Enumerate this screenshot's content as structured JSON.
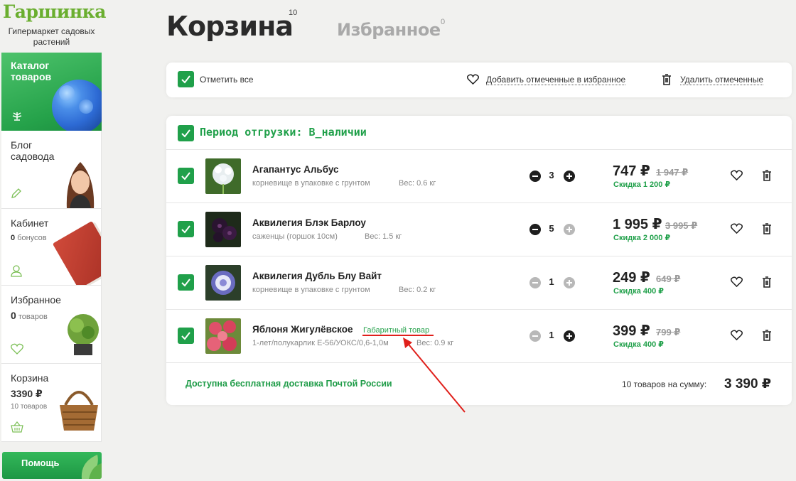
{
  "sidebar": {
    "logo": "Гаршинка",
    "tagline": "Гипермаркет садовых растений",
    "catalog": {
      "title": "Каталог товаров",
      "icon": "crown-leaf-icon"
    },
    "blog": {
      "title": "Блог садовода",
      "icon": "pencil-icon"
    },
    "cabinet": {
      "title": "Кабинет",
      "bonus_count": "0",
      "bonus_label": "бонусов",
      "icon": "user-icon"
    },
    "favorites": {
      "title": "Избранное",
      "count": "0",
      "count_label": "товаров",
      "icon": "heart-icon"
    },
    "cart": {
      "title": "Корзина",
      "sum": "3390 ₽",
      "count_text": "10 товаров",
      "icon": "basket-icon"
    },
    "help_label": "Помощь"
  },
  "tabs": {
    "cart_label": "Корзина",
    "cart_count": "10",
    "fav_label": "Избранное",
    "fav_count": "0"
  },
  "toolbar": {
    "select_all": "Отметить все",
    "add_to_fav": "Добавить отмеченные в избранное",
    "delete_marked": "Удалить отмеченные"
  },
  "cart": {
    "period_title": "Период отгрузки: В_наличии",
    "items": [
      {
        "name": "Агапантус Альбус",
        "desc": "корневище в упаковке с грунтом",
        "weight": "Вес: 0.6 кг",
        "qty": "3",
        "price": "747 ₽",
        "old_price": "1 947 ₽",
        "discount": "Скидка 1 200 ₽",
        "oversize": ""
      },
      {
        "name": "Аквилегия Блэк Барлоу",
        "desc": "саженцы (горшок 10см)",
        "weight": "Вес: 1.5 кг",
        "qty": "5",
        "price": "1 995 ₽",
        "old_price": "3 995 ₽",
        "discount": "Скидка 2 000 ₽",
        "oversize": ""
      },
      {
        "name": "Аквилегия Дубль Блу Вайт",
        "desc": "корневище в упаковке с грунтом",
        "weight": "Вес: 0.2 кг",
        "qty": "1",
        "price": "249 ₽",
        "old_price": "649 ₽",
        "discount": "Скидка 400 ₽",
        "oversize": ""
      },
      {
        "name": "Яблоня Жигулёвское",
        "desc": "1-лет/полукарлик Е-56/УОКС/0,6-1,0м",
        "weight": "Вес: 0.9 кг",
        "qty": "1",
        "price": "399 ₽",
        "old_price": "799 ₽",
        "discount": "Скидка 400 ₽",
        "oversize": "Габаритный товар"
      }
    ],
    "free_shipping": "Доступна бесплатная доставка Почтой России",
    "summary_label": "10 товаров на сумму:",
    "summary_total": "3 390 ₽"
  },
  "colors": {
    "accent": "#20a04a",
    "logo": "#6aae2f",
    "annotation": "#e0201b"
  }
}
